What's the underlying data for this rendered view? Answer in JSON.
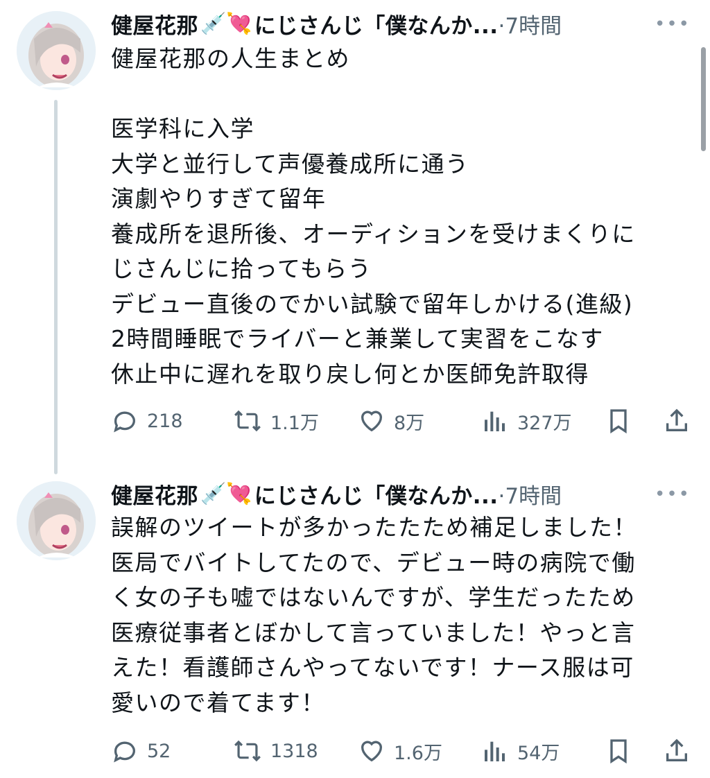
{
  "tweets": [
    {
      "author_name": "健屋花那",
      "name_emojis": "💉💘",
      "handle_trunc": "にじさんじ「僕なんか...",
      "time": "·7時間",
      "more": "•••",
      "lines": [
        "健屋花那の人生まとめ",
        "",
        "医学科に入学",
        "大学と並行して声優養成所に通う",
        "演劇やりすぎて留年",
        "養成所を退所後、オーディションを受けまくりに",
        "じさんじに拾ってもらう",
        "デビュー直後のでかい試験で留年しかける(進級)",
        "2時間睡眠でライバーと兼業して実習をこなす",
        "休止中に遅れを取り戻し何とか医師免許取得"
      ],
      "replies": "218",
      "reposts": "1.1万",
      "likes": "8万",
      "views": "327万"
    },
    {
      "author_name": "健屋花那",
      "name_emojis": "💉💘",
      "handle_trunc": "にじさんじ「僕なんか...",
      "time": "·7時間",
      "more": "•••",
      "lines": [
        "誤解のツイートが多かったたため補足しました！",
        "医局でバイトしてたので、デビュー時の病院で働",
        "く女の子も嘘ではないんですが、学生だったため",
        "医療従事者とぼかして言っていました！やっと言",
        "えた！看護師さんやってないです！ナース服は可",
        "愛いので着てます！"
      ],
      "replies": "52",
      "reposts": "1318",
      "likes": "1.6万",
      "views": "54万"
    }
  ]
}
